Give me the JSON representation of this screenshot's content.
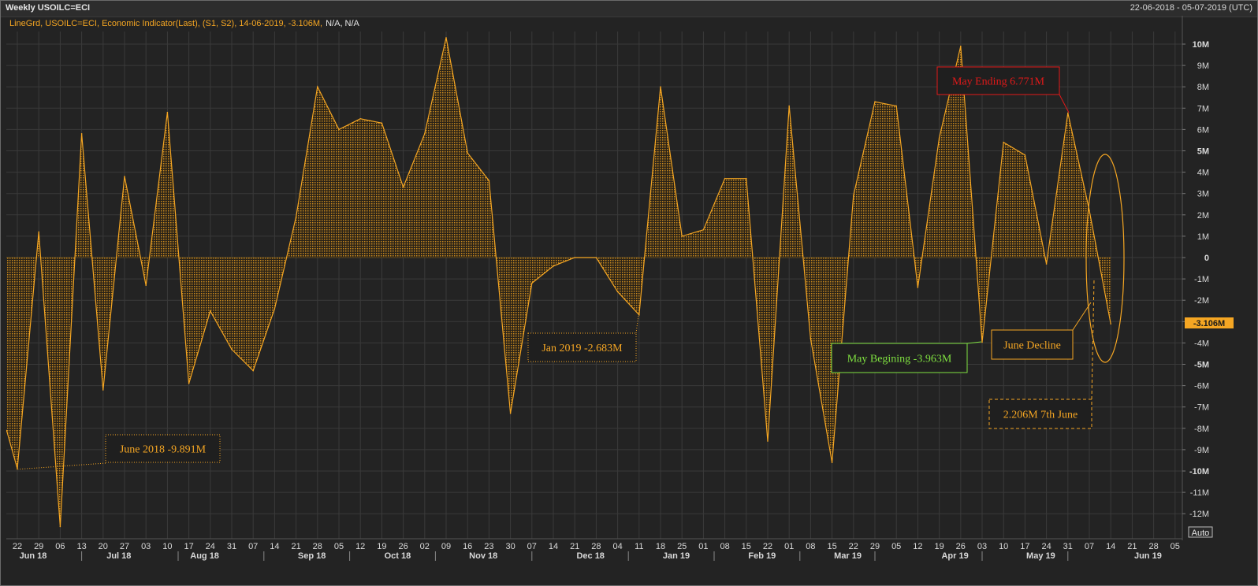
{
  "header": {
    "title": "Weekly USOILC=ECI",
    "date_range": "22-06-2018 - 05-07-2019 (UTC)"
  },
  "legend": {
    "text": "LineGrd, USOILC=ECI, Economic Indicator(Last), (S1, S2), 14-06-2019, -3.106M,",
    "na_text": "N/A, N/A"
  },
  "colors": {
    "series": "#f5a623",
    "fill": "#c98a1f",
    "grid": "#3a3a3a",
    "axis_text": "#d9d9d9",
    "annotation_red": "#e11919",
    "annotation_green": "#7fe040",
    "annotation_orange": "#f5a623",
    "last_value_badge": "#f5a623"
  },
  "chart_data": {
    "type": "area",
    "x_label": "",
    "y_unit": "M",
    "ylim": [
      -12.9,
      10.6
    ],
    "y_ticks": [
      10,
      9,
      8,
      7,
      6,
      5,
      4,
      3,
      2,
      1,
      0,
      -1,
      -2,
      -3,
      -4,
      -5,
      -6,
      -7,
      -8,
      -9,
      -10,
      -11,
      -12
    ],
    "y_tick_labels": [
      "10M",
      "9M",
      "8M",
      "7M",
      "6M",
      "5M",
      "4M",
      "3M",
      "2M",
      "1M",
      "0",
      "-1M",
      "-2M",
      "-3M",
      "-4M",
      "-5M",
      "-6M",
      "-7M",
      "-8M",
      "-9M",
      "-10M",
      "-11M",
      "-12M"
    ],
    "x_tick_labels": [
      "22",
      "29",
      "06",
      "13",
      "20",
      "27",
      "03",
      "10",
      "17",
      "24",
      "31",
      "07",
      "14",
      "21",
      "28",
      "05",
      "12",
      "19",
      "26",
      "02",
      "09",
      "16",
      "23",
      "30",
      "07",
      "14",
      "21",
      "28",
      "04",
      "11",
      "18",
      "25",
      "01",
      "08",
      "15",
      "22",
      "01",
      "08",
      "15",
      "22",
      "29",
      "05",
      "12",
      "19",
      "26",
      "03",
      "10",
      "17",
      "24",
      "31",
      "07",
      "14",
      "21",
      "28",
      "05"
    ],
    "month_labels": [
      {
        "label": "Jun 18",
        "tick": 0
      },
      {
        "label": "Jul 18",
        "tick": 4
      },
      {
        "label": "Aug 18",
        "tick": 8
      },
      {
        "label": "Sep 18",
        "tick": 13
      },
      {
        "label": "Oct 18",
        "tick": 17
      },
      {
        "label": "Nov 18",
        "tick": 21
      },
      {
        "label": "Dec 18",
        "tick": 26
      },
      {
        "label": "Jan 19",
        "tick": 30
      },
      {
        "label": "Feb 19",
        "tick": 34
      },
      {
        "label": "Mar 19",
        "tick": 38
      },
      {
        "label": "Apr 19",
        "tick": 43
      },
      {
        "label": "May 19",
        "tick": 47
      },
      {
        "label": "Jun 19",
        "tick": 52
      }
    ],
    "month_separators": [
      3,
      7.5,
      11.5,
      15.5,
      19.5,
      24,
      28.5,
      32.5,
      36.5,
      40,
      45,
      49
    ],
    "series": [
      {
        "values": [
          [
            -0.5,
            -8.1
          ],
          [
            0,
            -9.891
          ],
          [
            1,
            1.2
          ],
          [
            2,
            -12.6
          ],
          [
            3,
            5.8
          ],
          [
            4,
            -6.2
          ],
          [
            5,
            3.8
          ],
          [
            6,
            -1.3
          ],
          [
            7,
            6.8
          ],
          [
            8,
            -5.9
          ],
          [
            9,
            -2.5
          ],
          [
            10,
            -4.3
          ],
          [
            11,
            -5.3
          ],
          [
            12,
            -2.4
          ],
          [
            13,
            1.9
          ],
          [
            14,
            8.0
          ],
          [
            15,
            6.0
          ],
          [
            16,
            6.5
          ],
          [
            17,
            6.3
          ],
          [
            18,
            3.3
          ],
          [
            19,
            5.8
          ],
          [
            20,
            10.3
          ],
          [
            21,
            4.9
          ],
          [
            22,
            3.6
          ],
          [
            23,
            -7.3
          ],
          [
            24,
            -1.2
          ],
          [
            25,
            -0.4
          ],
          [
            26,
            0.0
          ],
          [
            27,
            0.0
          ],
          [
            28,
            -1.6
          ],
          [
            29,
            -2.683
          ],
          [
            30,
            8.0
          ],
          [
            31,
            1.0
          ],
          [
            32,
            1.3
          ],
          [
            33,
            3.7
          ],
          [
            34,
            3.7
          ],
          [
            35,
            -8.6
          ],
          [
            36,
            7.1
          ],
          [
            37,
            -3.8
          ],
          [
            38,
            -9.6
          ],
          [
            39,
            2.9
          ],
          [
            40,
            7.3
          ],
          [
            41,
            7.1
          ],
          [
            42,
            -1.4
          ],
          [
            43,
            5.6
          ],
          [
            44,
            9.9
          ],
          [
            45,
            -3.963
          ],
          [
            46,
            5.4
          ],
          [
            47,
            4.8
          ],
          [
            48,
            -0.3
          ],
          [
            49,
            6.771
          ],
          [
            50,
            2.206
          ],
          [
            51,
            -3.106
          ]
        ]
      }
    ],
    "last_value_label": "-3.106M",
    "auto_label": "Auto",
    "annotations": [
      {
        "text": "June 2018 -9.891M",
        "style": "dotted",
        "color": "orange"
      },
      {
        "text": "Jan 2019 -2.683M",
        "style": "dotted",
        "color": "orange"
      },
      {
        "text": "May Begining -3.963M",
        "style": "solid",
        "color": "green"
      },
      {
        "text": "May Ending 6.771M",
        "style": "solid",
        "color": "red"
      },
      {
        "text": "June Decline",
        "style": "solid",
        "color": "orange"
      },
      {
        "text": "2.206M 7th June",
        "style": "dashed",
        "color": "orange"
      }
    ],
    "grid": true
  }
}
